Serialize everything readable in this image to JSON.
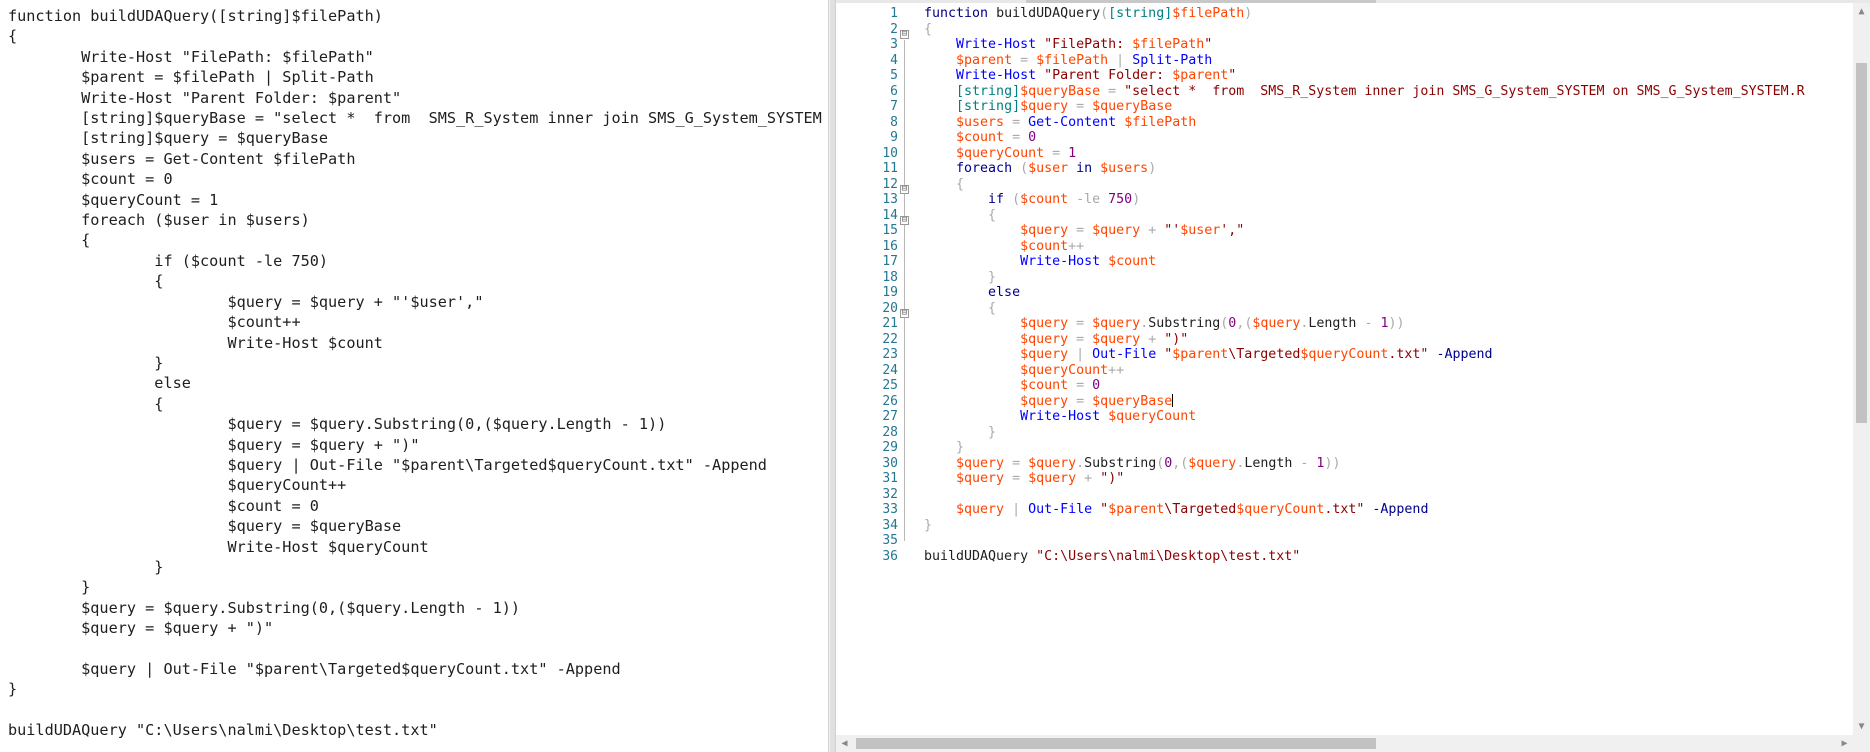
{
  "left_editor": {
    "lines": [
      "function buildUDAQuery([string]$filePath)",
      "{",
      "        Write-Host \"FilePath: $filePath\"",
      "        $parent = $filePath | Split-Path",
      "        Write-Host \"Parent Folder: $parent\"",
      "        [string]$queryBase = \"select *  from  SMS_R_System inner join SMS_G_System_SYSTEM",
      "        [string]$query = $queryBase",
      "        $users = Get-Content $filePath",
      "        $count = 0",
      "        $queryCount = 1",
      "        foreach ($user in $users)",
      "        {",
      "                if ($count -le 750)",
      "                {",
      "                        $query = $query + \"'$user',\"",
      "                        $count++",
      "                        Write-Host $count",
      "                }",
      "                else",
      "                {",
      "                        $query = $query.Substring(0,($query.Length - 1))",
      "                        $query = $query + \")\"",
      "                        $query | Out-File \"$parent\\Targeted$queryCount.txt\" -Append",
      "                        $queryCount++",
      "                        $count = 0",
      "                        $query = $queryBase",
      "                        Write-Host $queryCount",
      "                }",
      "        }",
      "        $query = $query.Substring(0,($query.Length - 1))",
      "        $query = $query + \")\"",
      "",
      "        $query | Out-File \"$parent\\Targeted$queryCount.txt\" -Append",
      "}",
      "",
      "buildUDAQuery \"C:\\Users\\nalmi\\Desktop\\test.txt\""
    ]
  },
  "right_editor": {
    "line_numbers": [
      "1",
      "2",
      "3",
      "4",
      "5",
      "6",
      "7",
      "8",
      "9",
      "10",
      "11",
      "12",
      "13",
      "14",
      "15",
      "16",
      "17",
      "18",
      "19",
      "20",
      "21",
      "22",
      "23",
      "24",
      "25",
      "26",
      "27",
      "28",
      "29",
      "30",
      "31",
      "32",
      "33",
      "34",
      "35",
      "36"
    ],
    "fold_markers": [
      "⊟",
      "⊟",
      "⊟",
      "⊟"
    ],
    "lines": [
      [
        {
          "c": "kw",
          "t": "function "
        },
        {
          "c": "fn",
          "t": "buildUDAQuery"
        },
        {
          "c": "op",
          "t": "("
        },
        {
          "c": "typ",
          "t": "[string]"
        },
        {
          "c": "var",
          "t": "$filePath"
        },
        {
          "c": "op",
          "t": ")"
        }
      ],
      [
        {
          "c": "op",
          "t": "{"
        }
      ],
      [
        {
          "c": "fn",
          "t": "    "
        },
        {
          "c": "cmd",
          "t": "Write-Host "
        },
        {
          "c": "str",
          "t": "\"FilePath: "
        },
        {
          "c": "var",
          "t": "$filePath"
        },
        {
          "c": "str",
          "t": "\""
        }
      ],
      [
        {
          "c": "fn",
          "t": "    "
        },
        {
          "c": "var",
          "t": "$parent"
        },
        {
          "c": "op",
          "t": " = "
        },
        {
          "c": "var",
          "t": "$filePath"
        },
        {
          "c": "op",
          "t": " | "
        },
        {
          "c": "cmd",
          "t": "Split-Path"
        }
      ],
      [
        {
          "c": "fn",
          "t": "    "
        },
        {
          "c": "cmd",
          "t": "Write-Host "
        },
        {
          "c": "str",
          "t": "\"Parent Folder: "
        },
        {
          "c": "var",
          "t": "$parent"
        },
        {
          "c": "str",
          "t": "\""
        }
      ],
      [
        {
          "c": "fn",
          "t": "    "
        },
        {
          "c": "typ",
          "t": "[string]"
        },
        {
          "c": "var",
          "t": "$queryBase"
        },
        {
          "c": "op",
          "t": " = "
        },
        {
          "c": "str",
          "t": "\"select *  from  SMS_R_System inner join SMS_G_System_SYSTEM on SMS_G_System_SYSTEM.R"
        }
      ],
      [
        {
          "c": "fn",
          "t": "    "
        },
        {
          "c": "typ",
          "t": "[string]"
        },
        {
          "c": "var",
          "t": "$query"
        },
        {
          "c": "op",
          "t": " = "
        },
        {
          "c": "var",
          "t": "$queryBase"
        }
      ],
      [
        {
          "c": "fn",
          "t": "    "
        },
        {
          "c": "var",
          "t": "$users"
        },
        {
          "c": "op",
          "t": " = "
        },
        {
          "c": "cmd",
          "t": "Get-Content "
        },
        {
          "c": "var",
          "t": "$filePath"
        }
      ],
      [
        {
          "c": "fn",
          "t": "    "
        },
        {
          "c": "var",
          "t": "$count"
        },
        {
          "c": "op",
          "t": " = "
        },
        {
          "c": "num",
          "t": "0"
        }
      ],
      [
        {
          "c": "fn",
          "t": "    "
        },
        {
          "c": "var",
          "t": "$queryCount"
        },
        {
          "c": "op",
          "t": " = "
        },
        {
          "c": "num",
          "t": "1"
        }
      ],
      [
        {
          "c": "fn",
          "t": "    "
        },
        {
          "c": "kw",
          "t": "foreach "
        },
        {
          "c": "op",
          "t": "("
        },
        {
          "c": "var",
          "t": "$user"
        },
        {
          "c": "kw",
          "t": " in "
        },
        {
          "c": "var",
          "t": "$users"
        },
        {
          "c": "op",
          "t": ")"
        }
      ],
      [
        {
          "c": "fn",
          "t": "    "
        },
        {
          "c": "op",
          "t": "{"
        }
      ],
      [
        {
          "c": "fn",
          "t": "        "
        },
        {
          "c": "kw",
          "t": "if "
        },
        {
          "c": "op",
          "t": "("
        },
        {
          "c": "var",
          "t": "$count"
        },
        {
          "c": "op",
          "t": " -le "
        },
        {
          "c": "num",
          "t": "750"
        },
        {
          "c": "op",
          "t": ")"
        }
      ],
      [
        {
          "c": "fn",
          "t": "        "
        },
        {
          "c": "op",
          "t": "{"
        }
      ],
      [
        {
          "c": "fn",
          "t": "            "
        },
        {
          "c": "var",
          "t": "$query"
        },
        {
          "c": "op",
          "t": " = "
        },
        {
          "c": "var",
          "t": "$query"
        },
        {
          "c": "op",
          "t": " + "
        },
        {
          "c": "str",
          "t": "\"'"
        },
        {
          "c": "var",
          "t": "$user"
        },
        {
          "c": "str",
          "t": "',\""
        }
      ],
      [
        {
          "c": "fn",
          "t": "            "
        },
        {
          "c": "var",
          "t": "$count"
        },
        {
          "c": "op",
          "t": "++"
        }
      ],
      [
        {
          "c": "fn",
          "t": "            "
        },
        {
          "c": "cmd",
          "t": "Write-Host "
        },
        {
          "c": "var",
          "t": "$count"
        }
      ],
      [
        {
          "c": "fn",
          "t": "        "
        },
        {
          "c": "op",
          "t": "}"
        }
      ],
      [
        {
          "c": "fn",
          "t": "        "
        },
        {
          "c": "kw",
          "t": "else"
        }
      ],
      [
        {
          "c": "fn",
          "t": "        "
        },
        {
          "c": "op",
          "t": "{"
        }
      ],
      [
        {
          "c": "fn",
          "t": "            "
        },
        {
          "c": "var",
          "t": "$query"
        },
        {
          "c": "op",
          "t": " = "
        },
        {
          "c": "var",
          "t": "$query"
        },
        {
          "c": "op",
          "t": "."
        },
        {
          "c": "fn",
          "t": "Substring"
        },
        {
          "c": "op",
          "t": "("
        },
        {
          "c": "num",
          "t": "0"
        },
        {
          "c": "op",
          "t": ",("
        },
        {
          "c": "var",
          "t": "$query"
        },
        {
          "c": "op",
          "t": "."
        },
        {
          "c": "fn",
          "t": "Length"
        },
        {
          "c": "op",
          "t": " - "
        },
        {
          "c": "num",
          "t": "1"
        },
        {
          "c": "op",
          "t": "))"
        }
      ],
      [
        {
          "c": "fn",
          "t": "            "
        },
        {
          "c": "var",
          "t": "$query"
        },
        {
          "c": "op",
          "t": " = "
        },
        {
          "c": "var",
          "t": "$query"
        },
        {
          "c": "op",
          "t": " + "
        },
        {
          "c": "str",
          "t": "\")\""
        }
      ],
      [
        {
          "c": "fn",
          "t": "            "
        },
        {
          "c": "var",
          "t": "$query"
        },
        {
          "c": "op",
          "t": " | "
        },
        {
          "c": "cmd",
          "t": "Out-File "
        },
        {
          "c": "str",
          "t": "\""
        },
        {
          "c": "var",
          "t": "$parent"
        },
        {
          "c": "str",
          "t": "\\Targeted"
        },
        {
          "c": "var",
          "t": "$queryCount"
        },
        {
          "c": "str",
          "t": ".txt\""
        },
        {
          "c": "fn",
          "t": " "
        },
        {
          "c": "kw",
          "t": "-Append"
        }
      ],
      [
        {
          "c": "fn",
          "t": "            "
        },
        {
          "c": "var",
          "t": "$queryCount"
        },
        {
          "c": "op",
          "t": "++"
        }
      ],
      [
        {
          "c": "fn",
          "t": "            "
        },
        {
          "c": "var",
          "t": "$count"
        },
        {
          "c": "op",
          "t": " = "
        },
        {
          "c": "num",
          "t": "0"
        }
      ],
      [
        {
          "c": "fn",
          "t": "            "
        },
        {
          "c": "var",
          "t": "$query"
        },
        {
          "c": "op",
          "t": " = "
        },
        {
          "c": "var",
          "t": "$queryBase"
        },
        {
          "c": "caret",
          "t": ""
        }
      ],
      [
        {
          "c": "fn",
          "t": "            "
        },
        {
          "c": "cmd",
          "t": "Write-Host "
        },
        {
          "c": "var",
          "t": "$queryCount"
        }
      ],
      [
        {
          "c": "fn",
          "t": "        "
        },
        {
          "c": "op",
          "t": "}"
        }
      ],
      [
        {
          "c": "fn",
          "t": "    "
        },
        {
          "c": "op",
          "t": "}"
        }
      ],
      [
        {
          "c": "fn",
          "t": "    "
        },
        {
          "c": "var",
          "t": "$query"
        },
        {
          "c": "op",
          "t": " = "
        },
        {
          "c": "var",
          "t": "$query"
        },
        {
          "c": "op",
          "t": "."
        },
        {
          "c": "fn",
          "t": "Substring"
        },
        {
          "c": "op",
          "t": "("
        },
        {
          "c": "num",
          "t": "0"
        },
        {
          "c": "op",
          "t": ",("
        },
        {
          "c": "var",
          "t": "$query"
        },
        {
          "c": "op",
          "t": "."
        },
        {
          "c": "fn",
          "t": "Length"
        },
        {
          "c": "op",
          "t": " - "
        },
        {
          "c": "num",
          "t": "1"
        },
        {
          "c": "op",
          "t": "))"
        }
      ],
      [
        {
          "c": "fn",
          "t": "    "
        },
        {
          "c": "var",
          "t": "$query"
        },
        {
          "c": "op",
          "t": " = "
        },
        {
          "c": "var",
          "t": "$query"
        },
        {
          "c": "op",
          "t": " + "
        },
        {
          "c": "str",
          "t": "\")\""
        }
      ],
      [
        {
          "c": "fn",
          "t": ""
        }
      ],
      [
        {
          "c": "fn",
          "t": "    "
        },
        {
          "c": "var",
          "t": "$query"
        },
        {
          "c": "op",
          "t": " | "
        },
        {
          "c": "cmd",
          "t": "Out-File "
        },
        {
          "c": "str",
          "t": "\""
        },
        {
          "c": "var",
          "t": "$parent"
        },
        {
          "c": "str",
          "t": "\\Targeted"
        },
        {
          "c": "var",
          "t": "$queryCount"
        },
        {
          "c": "str",
          "t": ".txt\""
        },
        {
          "c": "fn",
          "t": " "
        },
        {
          "c": "kw",
          "t": "-Append"
        }
      ],
      [
        {
          "c": "op",
          "t": "}"
        }
      ],
      [
        {
          "c": "fn",
          "t": ""
        }
      ],
      [
        {
          "c": "fn",
          "t": "buildUDAQuery "
        },
        {
          "c": "str",
          "t": "\"C:\\Users\\nalmi\\Desktop\\test.txt\""
        }
      ]
    ]
  },
  "scrollbars": {
    "up_arrow_icon": "▲",
    "down_arrow_icon": "▼",
    "left_arrow_icon": "◀",
    "right_arrow_icon": "▶"
  },
  "colors": {
    "keyword": "#00008b",
    "variable": "#ff4500",
    "cmdlet": "#0000ff",
    "string": "#8b0000",
    "type": "#008080",
    "number": "#800080",
    "line_number": "#237893"
  }
}
